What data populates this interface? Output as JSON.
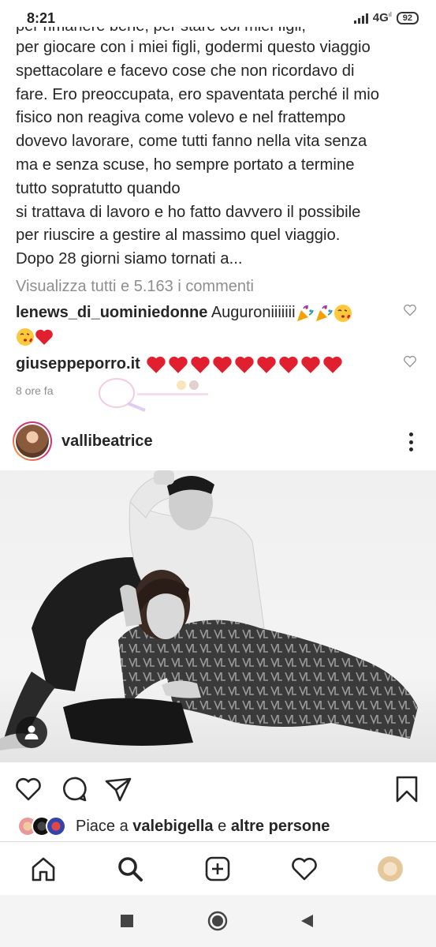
{
  "status_bar": {
    "time": "8:21",
    "network": "4G",
    "network_sub": "ıl",
    "battery": "92"
  },
  "caption": {
    "partial_top_line": "per rimanere bene, per stare coi miei figli,",
    "lines": [
      "per giocare con i miei figli, godermi questo viaggio",
      "spettacolare e facevo cose che non ricordavo di",
      "fare. Ero preoccupata, ero spaventata perché il mio",
      "fisico non reagiva come volevo e nel frattempo",
      "dovevo lavorare, come tutti fanno nella vita senza",
      "ma e senza scuse, ho sempre portato a termine",
      "tutto sopratutto quando",
      "si trattava di lavoro e ho fatto davvero il possibile",
      "per riuscire a gestire al massimo quel viaggio.",
      "Dopo 28 giorni siamo tornati a..."
    ]
  },
  "view_all_comments": "Visualizza tutti e 5.163 i commenti",
  "comments": [
    {
      "user": "lenews_di_uominiedonne",
      "text": "Auguroniiiiiii"
    },
    {
      "user": "giuseppeporro.it",
      "text": ""
    }
  ],
  "timestamp": "8 ore fa",
  "post": {
    "username": "vallibeatrice",
    "likes_prefix": "Piace a",
    "likes_user": "valebigella",
    "likes_conj": "e",
    "likes_others": "altre persone"
  },
  "colors": {
    "text": "#262626",
    "muted": "#8e8e8e",
    "heart_red": "#e0202e",
    "border": "#dbdbdb"
  },
  "icons": {
    "nav": [
      "home-icon",
      "search-icon",
      "new-post-icon",
      "activity-heart-icon",
      "profile-avatar"
    ],
    "actions": [
      "like-icon",
      "comment-icon",
      "share-icon",
      "save-icon"
    ]
  }
}
